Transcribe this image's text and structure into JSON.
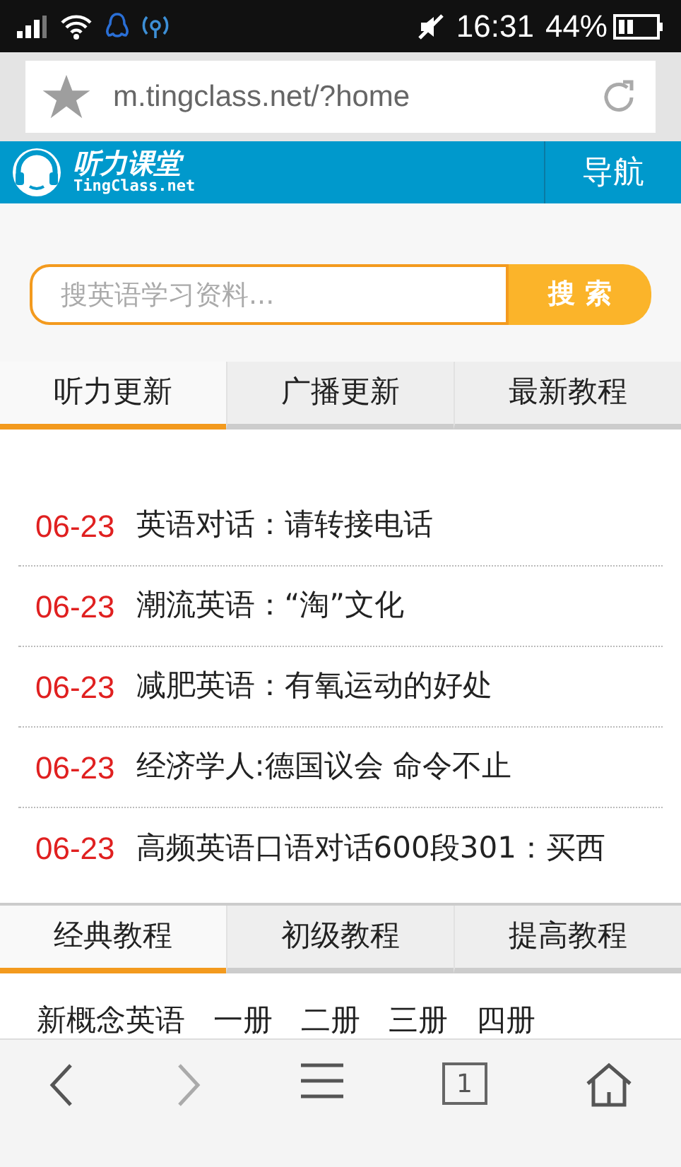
{
  "status_bar": {
    "time": "16:31",
    "battery_percent": "44%"
  },
  "address_bar": {
    "url": "m.tingclass.net/?home"
  },
  "header": {
    "logo_title": "听力课堂",
    "logo_subtitle": "TingClass.net",
    "nav_button": "导航"
  },
  "search": {
    "placeholder": "搜英语学习资料...",
    "button": "搜 索"
  },
  "news_tabs": [
    {
      "label": "听力更新",
      "selected": true
    },
    {
      "label": "广播更新",
      "selected": false
    },
    {
      "label": "最新教程",
      "selected": false
    }
  ],
  "news_items": [
    {
      "date": "06-23",
      "title": "英语对话：请转接电话"
    },
    {
      "date": "06-23",
      "title": "潮流英语：“淘”文化"
    },
    {
      "date": "06-23",
      "title": "减肥英语：有氧运动的好处"
    },
    {
      "date": "06-23",
      "title": "经济学人:德国议会 命令不止"
    },
    {
      "date": "06-23",
      "title": "高频英语口语对话600段301：买西"
    }
  ],
  "course_tabs": [
    {
      "label": "经典教程",
      "selected": true
    },
    {
      "label": "初级教程",
      "selected": false
    },
    {
      "label": "提高教程",
      "selected": false
    }
  ],
  "course_links": [
    "新概念英语",
    "一册",
    "二册",
    "三册",
    "四册"
  ],
  "toolbar": {
    "tab_count": "1"
  }
}
